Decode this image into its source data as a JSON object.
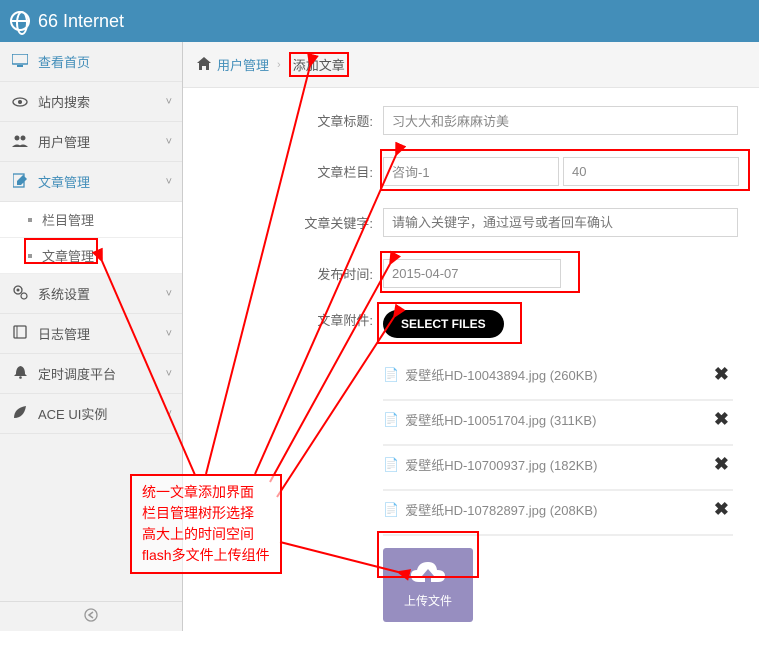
{
  "topbar": {
    "title": "66 Internet"
  },
  "sidebar": {
    "items": [
      {
        "icon": "monitor",
        "label": "查看首页",
        "chevron": ""
      },
      {
        "icon": "eye",
        "label": "站内搜索",
        "chevron": "˅"
      },
      {
        "icon": "users",
        "label": "用户管理",
        "chevron": "˅"
      },
      {
        "icon": "edit",
        "label": "文章管理",
        "chevron": "˅",
        "active": true
      },
      {
        "icon": "cogs",
        "label": "系统设置",
        "chevron": "˅"
      },
      {
        "icon": "book",
        "label": "日志管理",
        "chevron": "˅"
      },
      {
        "icon": "bell",
        "label": "定时调度平台",
        "chevron": "˅"
      },
      {
        "icon": "leaf",
        "label": "ACE UI实例",
        "chevron": "˅"
      }
    ],
    "subitems": [
      {
        "label": "栏目管理"
      },
      {
        "label": "文章管理"
      }
    ]
  },
  "breadcrumb": {
    "link": "用户管理",
    "current": "添加文章"
  },
  "form": {
    "title_label": "文章标题",
    "title_value": "习大大和彭麻麻访美",
    "column_label": "文章栏目",
    "column_name": "咨询-1",
    "column_id": "40",
    "keyword_label": "文章关键字",
    "keyword_placeholder": "请输入关键字，通过逗号或者回车确认",
    "publish_label": "发布时间",
    "publish_value": "2015-04-07",
    "attach_label": "文章附件",
    "select_files": "SELECT FILES",
    "upload_text": "上传文件"
  },
  "files": [
    {
      "name": "爱壁纸HD-10043894.jpg (260KB)"
    },
    {
      "name": "爱壁纸HD-10051704.jpg (311KB)"
    },
    {
      "name": "爱壁纸HD-10700937.jpg (182KB)"
    },
    {
      "name": "爱壁纸HD-10782897.jpg (208KB)"
    }
  ],
  "annotation": {
    "line1": "统一文章添加界面",
    "line2": "栏目管理树形选择",
    "line3": "高大上的时间空间",
    "line4": "flash多文件上传组件"
  }
}
